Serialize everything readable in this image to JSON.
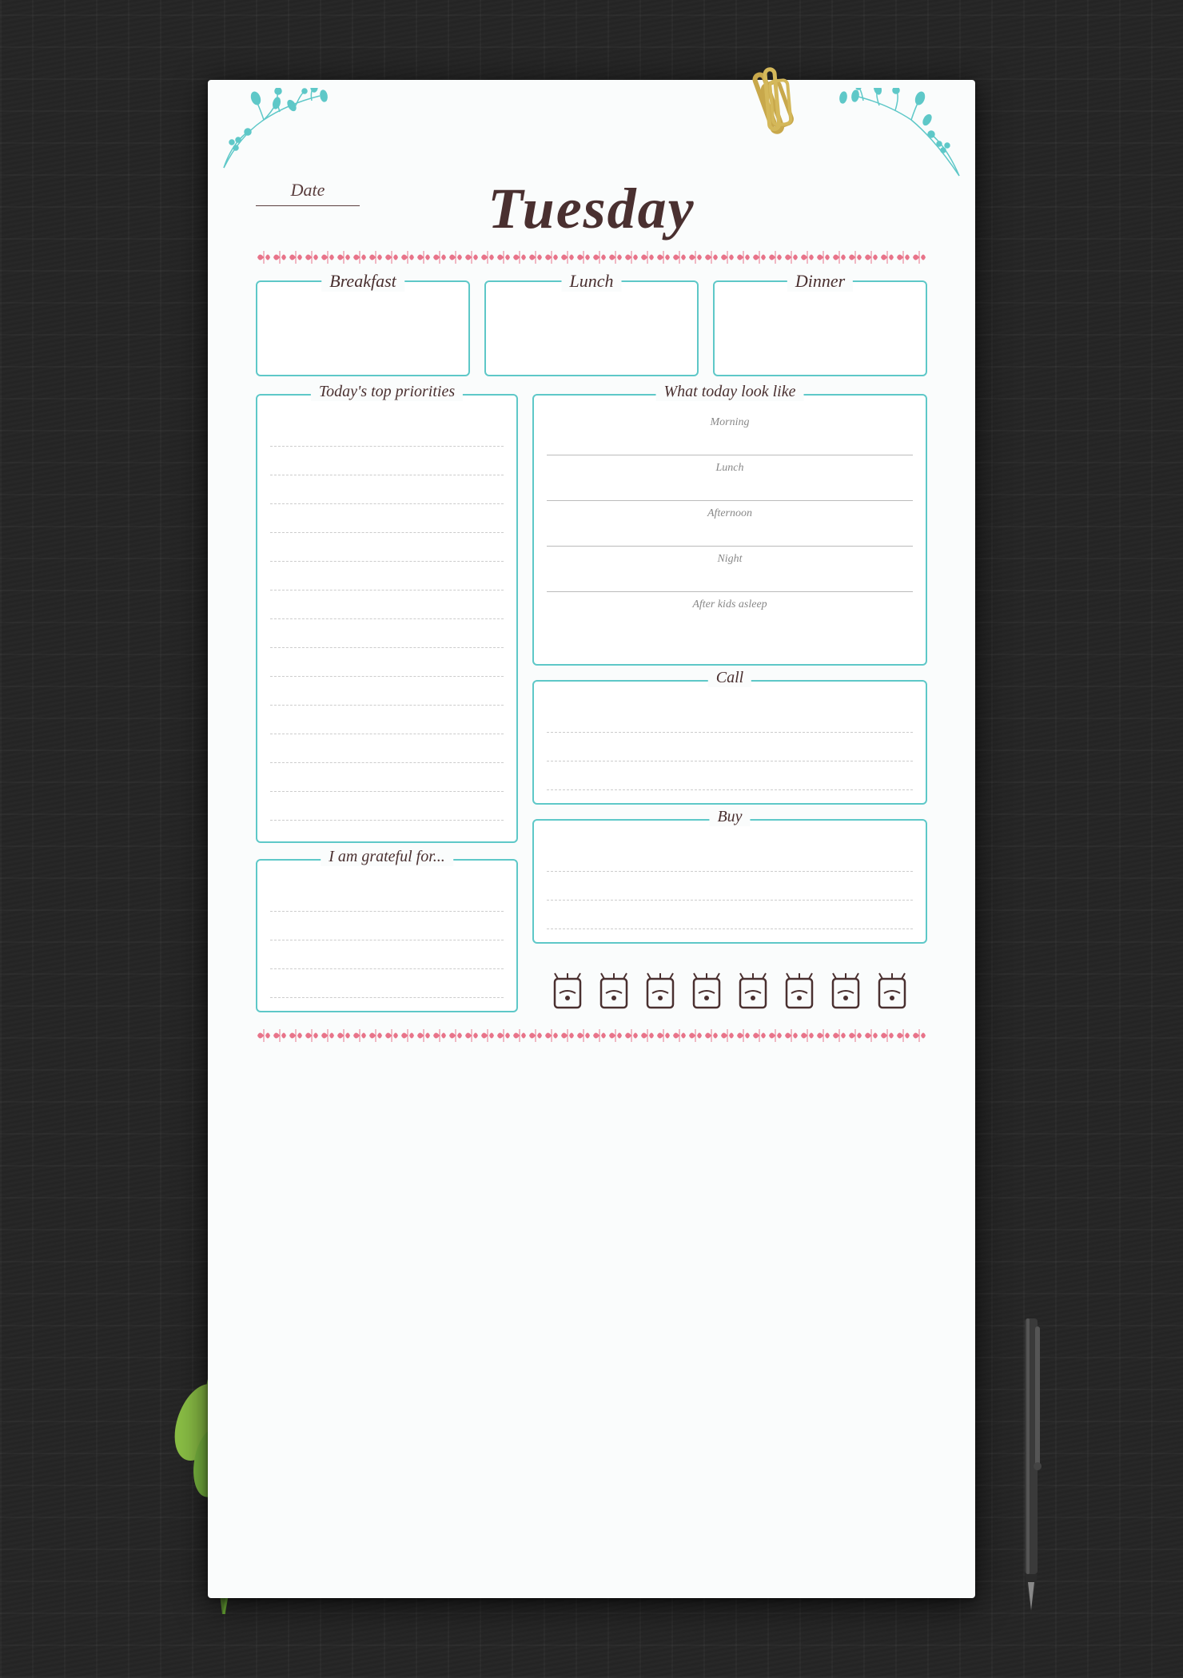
{
  "page": {
    "day": "Tuesday",
    "date_label": "Date",
    "accent_color": "#5ec8c8",
    "pink_color": "#e8748a"
  },
  "meals": [
    {
      "id": "breakfast",
      "label": "Breakfast"
    },
    {
      "id": "lunch",
      "label": "Lunch"
    },
    {
      "id": "dinner",
      "label": "Dinner"
    }
  ],
  "sections": {
    "priorities": {
      "label": "Today's top priorities",
      "lines": 14
    },
    "grateful": {
      "label": "I am grateful for..."
    },
    "today_look": {
      "label": "What today look like",
      "time_slots": [
        "Morning",
        "Lunch",
        "Afternoon",
        "Night",
        "After kids asleep"
      ]
    },
    "call": {
      "label": "Call"
    },
    "buy": {
      "label": "Buy"
    }
  },
  "water": {
    "cups_count": 8,
    "label": "water tracker"
  }
}
